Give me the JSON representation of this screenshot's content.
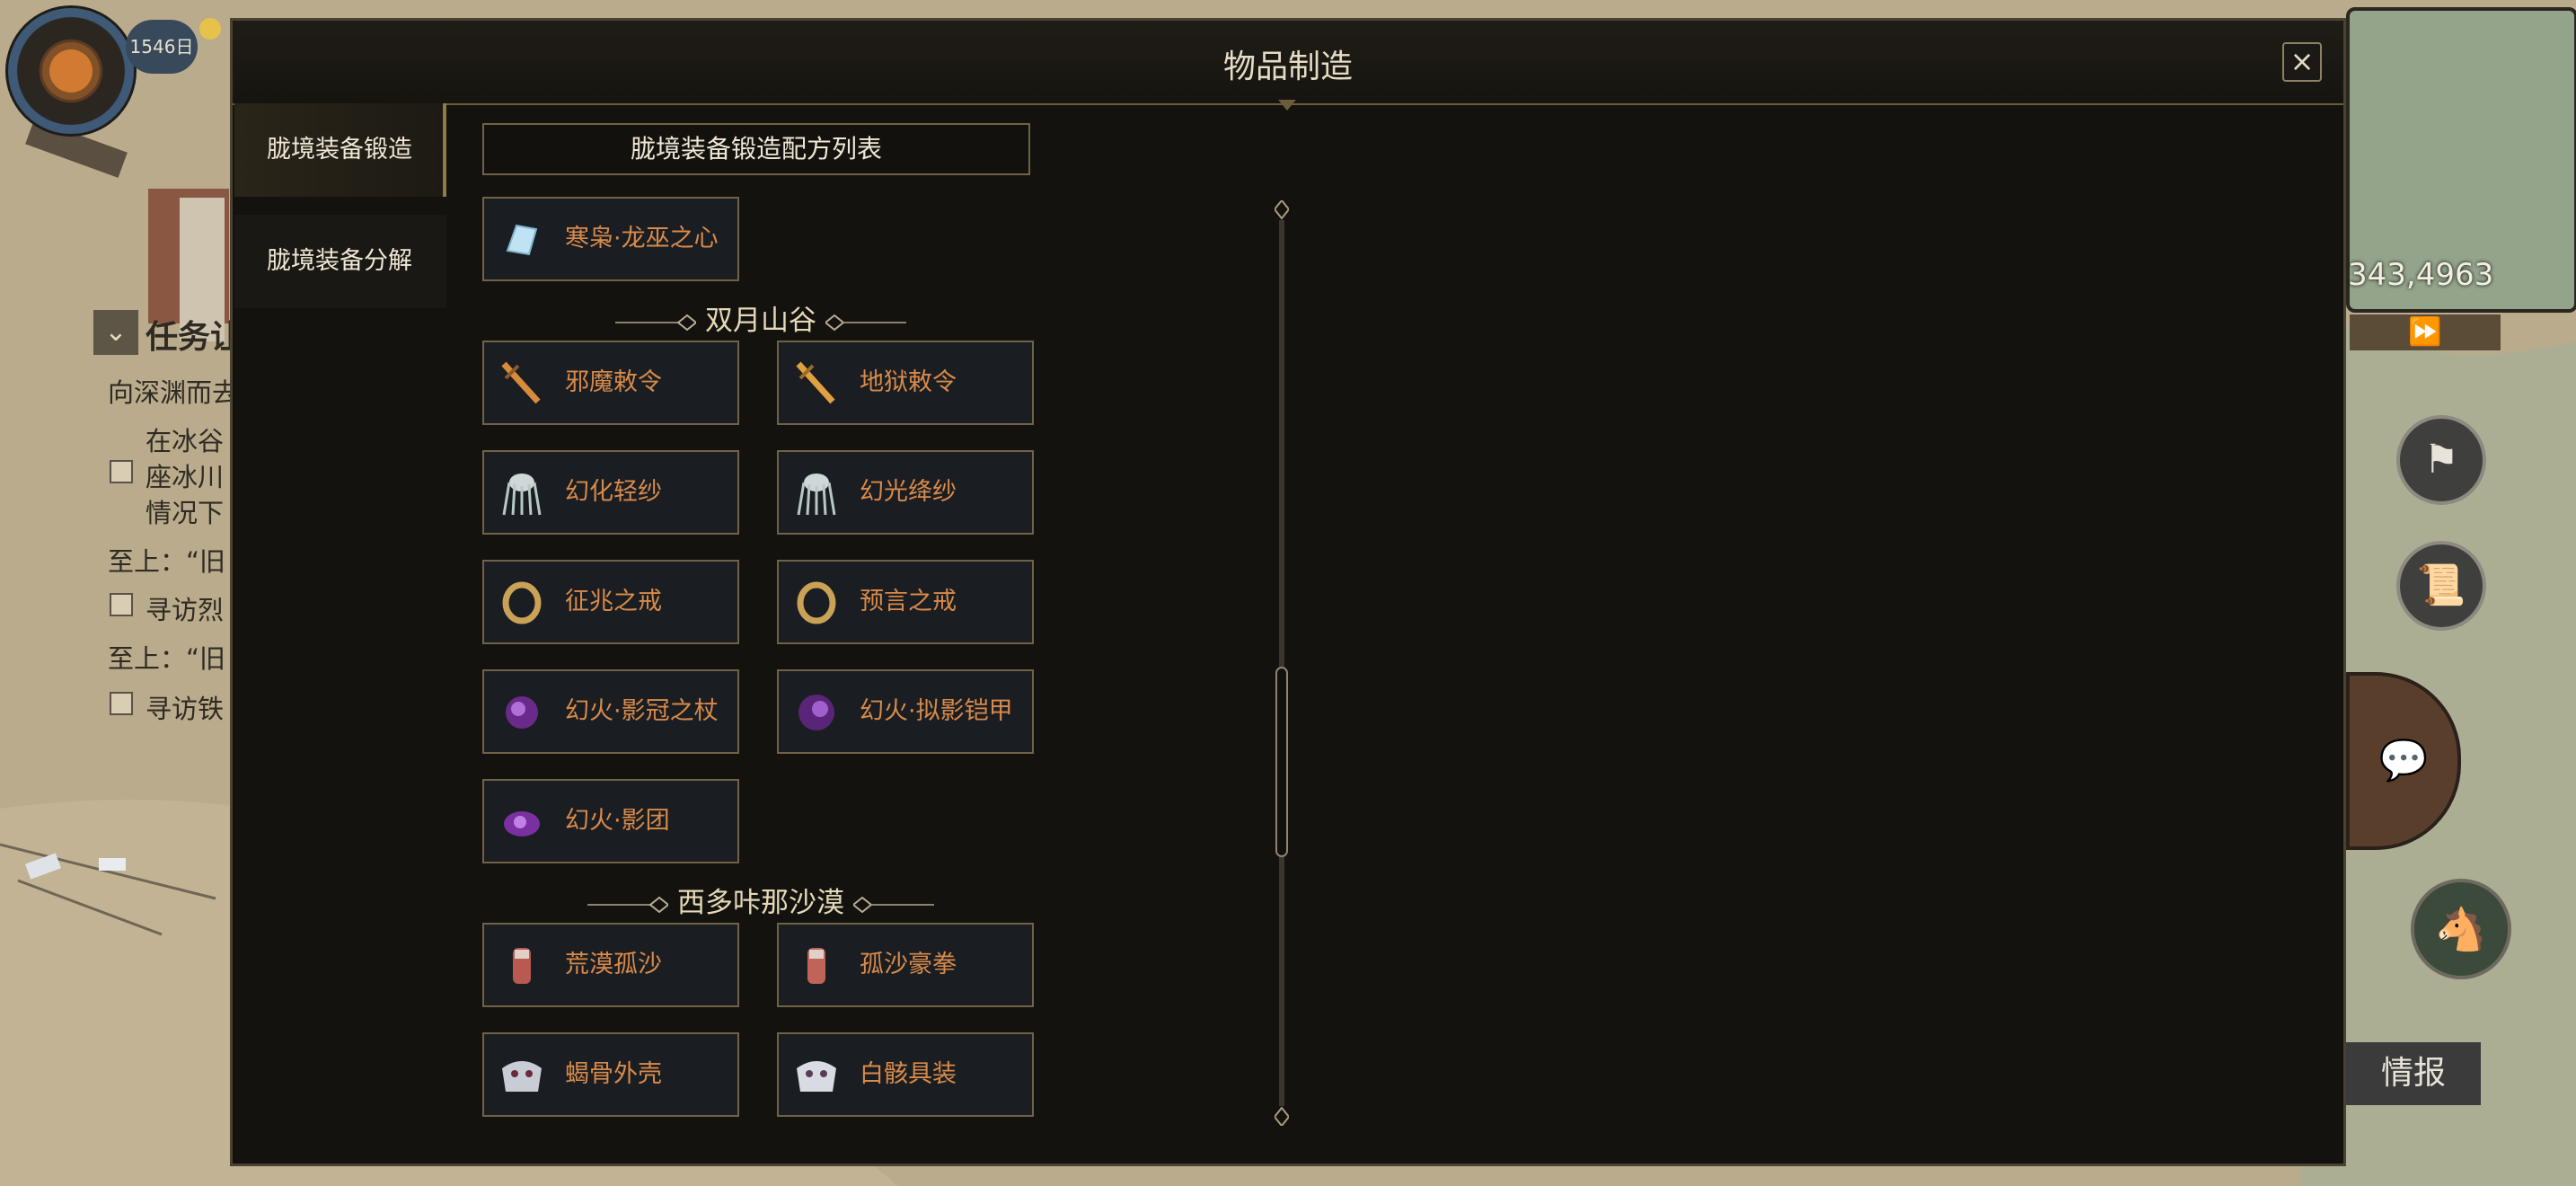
{
  "modal": {
    "title": "物品制造",
    "close_label": "×",
    "tabs": [
      {
        "label": "胧境装备锻造",
        "active": true
      },
      {
        "label": "胧境装备分解",
        "active": false
      }
    ],
    "list_header": "胧境装备锻造配方列表",
    "sections": [
      {
        "name": "",
        "items": [
          {
            "label": "寒枭·龙巫之心",
            "icon": "crystal-icon"
          }
        ]
      },
      {
        "name": "双月山谷",
        "items": [
          {
            "label": "邪魔敕令",
            "icon": "sword-icon"
          },
          {
            "label": "地狱敕令",
            "icon": "sword-icon"
          },
          {
            "label": "幻化轻纱",
            "icon": "veil-icon"
          },
          {
            "label": "幻光绛纱",
            "icon": "veil-icon"
          },
          {
            "label": "征兆之戒",
            "icon": "ring-icon"
          },
          {
            "label": "预言之戒",
            "icon": "ring-icon"
          },
          {
            "label": "幻火·影冠之杖",
            "icon": "purple-flame-icon"
          },
          {
            "label": "幻火·拟影铠甲",
            "icon": "purple-flame-icon"
          },
          {
            "label": "幻火·影团",
            "icon": "purple-flame-icon"
          }
        ]
      },
      {
        "name": "西多咔那沙漠",
        "items": [
          {
            "label": "荒漠孤沙",
            "icon": "gauntlet-icon"
          },
          {
            "label": "孤沙豪拳",
            "icon": "gauntlet-icon"
          },
          {
            "label": "蝎骨外壳",
            "icon": "armor-icon"
          },
          {
            "label": "白骸具装",
            "icon": "armor-icon"
          }
        ]
      }
    ],
    "colors": {
      "item_text": "#d98a4a",
      "panel_bg": "#13120f",
      "border": "#6f6246"
    }
  },
  "hud": {
    "day_label": "1546日",
    "coords": "343,4963",
    "intel_button": "情报",
    "fast_forward_icon": "fast-forward-icon"
  },
  "quest": {
    "title_fragment": "任务让",
    "lines": [
      "向深渊而去",
      "在冰谷",
      "座冰川",
      "情况下",
      "至上：“旧",
      "寻访烈",
      "至上：“旧",
      "寻访铁"
    ]
  }
}
